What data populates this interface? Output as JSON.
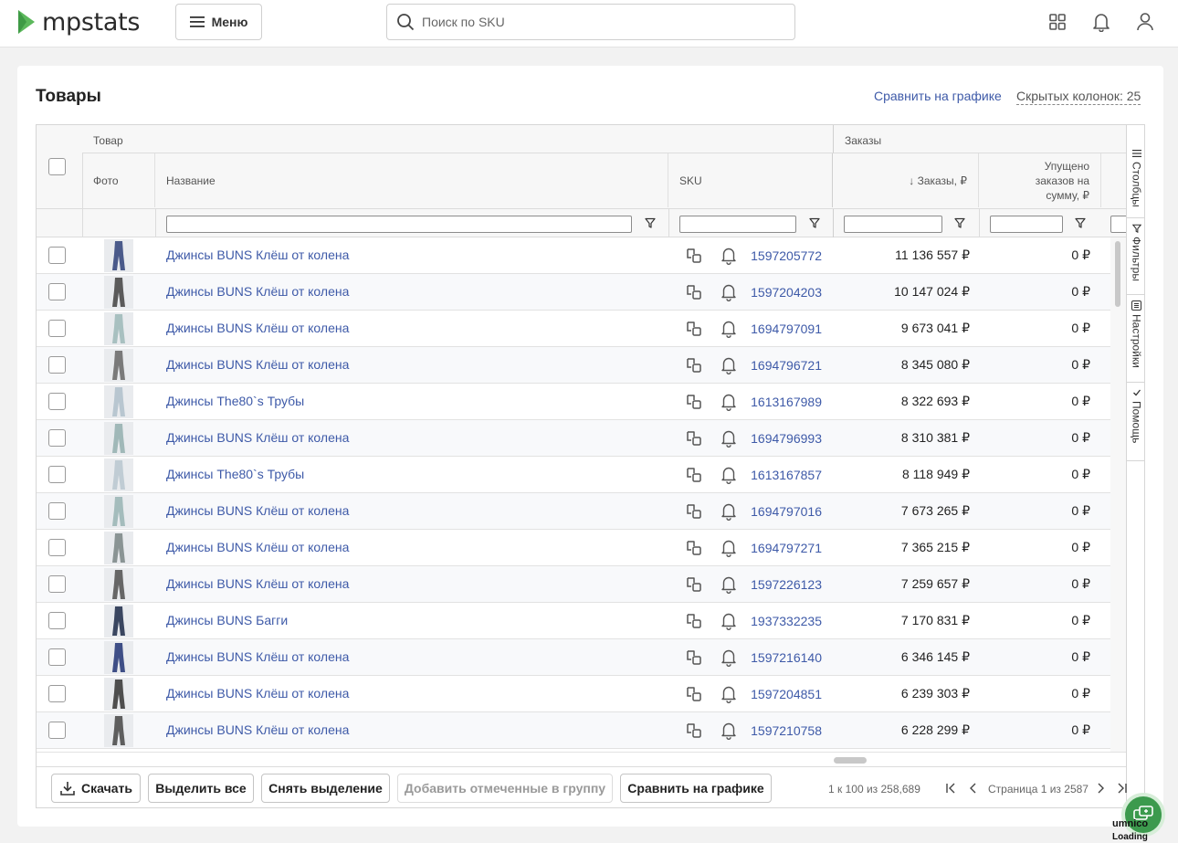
{
  "header": {
    "logo_text": "mpstats",
    "menu_label": "Меню",
    "search_placeholder": "Поиск по SKU",
    "brand_color": "#5cb85c"
  },
  "card": {
    "title": "Товары",
    "compare_link": "Сравнить на графике",
    "hidden_columns": "Скрытых колонок: 25"
  },
  "table": {
    "groups": {
      "product": "Товар",
      "orders": "Заказы"
    },
    "columns": {
      "photo": "Фото",
      "name": "Название",
      "sku": "SKU",
      "orders": "↓ Заказы, ₽",
      "missed_line1": "Упущено",
      "missed_line2": "заказов на",
      "missed_line3": "сумму, ₽"
    },
    "rows": [
      {
        "name": "Джинсы BUNS Клёш от колена",
        "sku": "1597205772",
        "orders": "11 136 557 ₽",
        "missed": "0 ₽",
        "thumb": "#4a5a8a"
      },
      {
        "name": "Джинсы BUNS Клёш от колена",
        "sku": "1597204203",
        "orders": "10 147 024 ₽",
        "missed": "0 ₽",
        "thumb": "#5a5a5a"
      },
      {
        "name": "Джинсы BUNS Клёш от колена",
        "sku": "1694797091",
        "orders": "9 673 041 ₽",
        "missed": "0 ₽",
        "thumb": "#a8c0c0"
      },
      {
        "name": "Джинсы BUNS Клёш от колена",
        "sku": "1694796721",
        "orders": "8 345 080 ₽",
        "missed": "0 ₽",
        "thumb": "#7a7a7a"
      },
      {
        "name": "Джинсы The80`s Трубы",
        "sku": "1613167989",
        "orders": "8 322 693 ₽",
        "missed": "0 ₽",
        "thumb": "#b8c6d0"
      },
      {
        "name": "Джинсы BUNS Клёш от колена",
        "sku": "1694796993",
        "orders": "8 310 381 ₽",
        "missed": "0 ₽",
        "thumb": "#a0b8b8"
      },
      {
        "name": "Джинсы The80`s Трубы",
        "sku": "1613167857",
        "orders": "8 118 949 ₽",
        "missed": "0 ₽",
        "thumb": "#c0ccd4"
      },
      {
        "name": "Джинсы BUNS Клёш от колена",
        "sku": "1694797016",
        "orders": "7 673 265 ₽",
        "missed": "0 ₽",
        "thumb": "#a4bcbc"
      },
      {
        "name": "Джинсы BUNS Клёш от колена",
        "sku": "1694797271",
        "orders": "7 365 215 ₽",
        "missed": "0 ₽",
        "thumb": "#8a9494"
      },
      {
        "name": "Джинсы BUNS Клёш от колена",
        "sku": "1597226123",
        "orders": "7 259 657 ₽",
        "missed": "0 ₽",
        "thumb": "#666666"
      },
      {
        "name": "Джинсы BUNS Багги",
        "sku": "1937332235",
        "orders": "7 170 831 ₽",
        "missed": "0 ₽",
        "thumb": "#3a4660"
      },
      {
        "name": "Джинсы BUNS Клёш от колена",
        "sku": "1597216140",
        "orders": "6 346 145 ₽",
        "missed": "0 ₽",
        "thumb": "#3e4e86"
      },
      {
        "name": "Джинсы BUNS Клёш от колена",
        "sku": "1597204851",
        "orders": "6 239 303 ₽",
        "missed": "0 ₽",
        "thumb": "#4e4e4e"
      },
      {
        "name": "Джинсы BUNS Клёш от колена",
        "sku": "1597210758",
        "orders": "6 228 299 ₽",
        "missed": "0 ₽",
        "thumb": "#5e5e5e"
      }
    ]
  },
  "side_panel": {
    "columns": "Столбцы",
    "filters": "Фильтры",
    "settings": "Настройки",
    "help": "Помощь"
  },
  "footer": {
    "download": "Скачать",
    "select_all": "Выделить все",
    "deselect": "Снять выделение",
    "add_to_group": "Добавить отмеченные в группу",
    "compare": "Сравнить на графике",
    "range": "1 к 100 из 258,689",
    "page": "Страница 1 из 2587"
  },
  "widget": {
    "name": "umnico",
    "status": "Loading"
  }
}
